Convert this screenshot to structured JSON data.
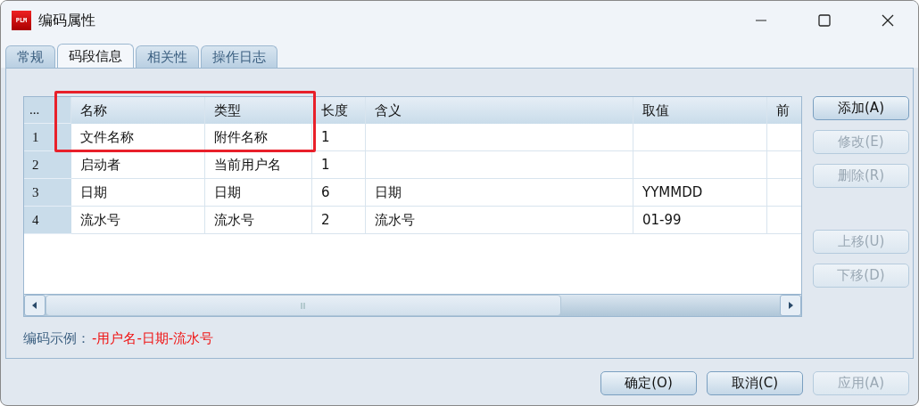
{
  "window": {
    "title": "编码属性",
    "logo": "PLM"
  },
  "tabs": [
    {
      "label": "常规",
      "selected": false
    },
    {
      "label": "码段信息",
      "selected": true
    },
    {
      "label": "相关性",
      "selected": false
    },
    {
      "label": "操作日志",
      "selected": false
    }
  ],
  "table": {
    "corner": "...",
    "columns": [
      "名称",
      "类型",
      "长度",
      "含义",
      "取值",
      "前"
    ],
    "rows": [
      {
        "index": "1",
        "cells": [
          "文件名称",
          "附件名称",
          "1",
          "",
          "",
          ""
        ]
      },
      {
        "index": "2",
        "cells": [
          "启动者",
          "当前用户名",
          "1",
          "",
          "",
          ""
        ]
      },
      {
        "index": "3",
        "cells": [
          "日期",
          "日期",
          "6",
          "日期",
          "YYMMDD",
          ""
        ]
      },
      {
        "index": "4",
        "cells": [
          "流水号",
          "流水号",
          "2",
          "流水号",
          "01-99",
          ""
        ]
      }
    ]
  },
  "side_buttons": [
    {
      "label": "添加(A)",
      "disabled": false
    },
    {
      "label": "修改(E)",
      "disabled": true
    },
    {
      "label": "删除(R)",
      "disabled": true
    },
    {
      "label": "上移(U)",
      "disabled": true,
      "gap_before": true
    },
    {
      "label": "下移(D)",
      "disabled": true
    }
  ],
  "example": {
    "label": "编码示例：",
    "value": "-用户名-日期-流水号"
  },
  "footer_buttons": [
    {
      "label": "确定(O)",
      "disabled": false
    },
    {
      "label": "取消(C)",
      "disabled": false
    },
    {
      "label": "应用(A)",
      "disabled": true
    }
  ]
}
